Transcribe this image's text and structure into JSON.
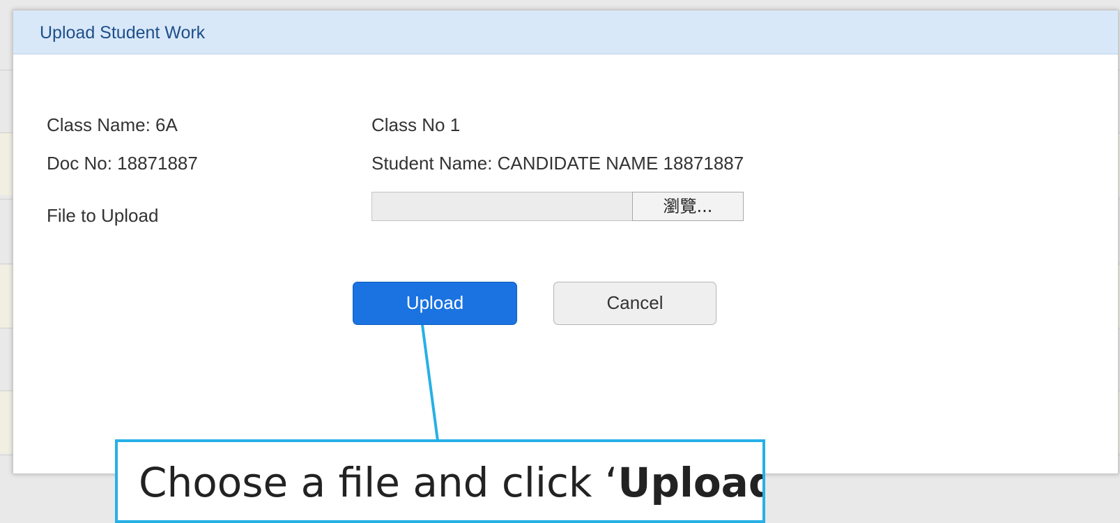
{
  "dialog": {
    "title": "Upload Student Work",
    "class_name": "Class Name: 6A",
    "class_no": "Class No 1",
    "doc_no": "Doc No: 18871887",
    "student_name": "Student Name: CANDIDATE NAME 18871887",
    "file_label": "File to Upload",
    "browse_label": "瀏覽...",
    "upload_label": "Upload",
    "cancel_label": "Cancel"
  },
  "annotation": {
    "text_prefix": "Choose a file and click ‘",
    "text_bold": "Upload",
    "text_suffix": "’"
  },
  "colors": {
    "header_bg": "#d9e8f9",
    "upload_button": "#1a73e0",
    "callout_border": "#27b0e6"
  }
}
